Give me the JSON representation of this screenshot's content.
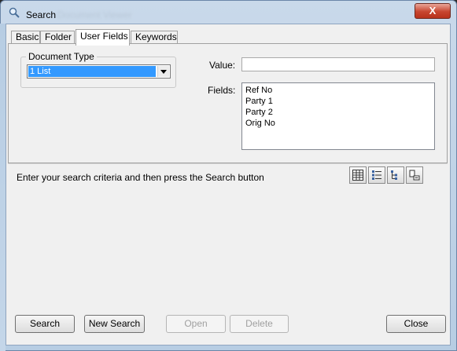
{
  "window": {
    "title": "Search",
    "title_suffix_blurred": "Document Viewer",
    "close_glyph": "X"
  },
  "tabs": [
    {
      "label": "Basic",
      "active": false
    },
    {
      "label": "Folder",
      "active": false
    },
    {
      "label": "User Fields",
      "active": true
    },
    {
      "label": "Keywords",
      "active": false
    }
  ],
  "user_fields": {
    "document_type_label": "Document Type",
    "document_type_value": "1 List",
    "value_label": "Value:",
    "value_input": "",
    "fields_label": "Fields:",
    "fields": [
      "Ref No",
      "Party 1",
      "Party 2",
      "Orig No"
    ]
  },
  "instruction": "Enter your search criteria and then press the Search button",
  "view_icons": [
    "details-view-icon",
    "list-view-icon",
    "tree-view-icon",
    "preview-icon"
  ],
  "buttons": {
    "search": "Search",
    "new_search": "New Search",
    "open": "Open",
    "delete": "Delete",
    "close": "Close"
  },
  "colors": {
    "selection": "#3399ff",
    "client_bg": "#f0f0f0",
    "close_red": "#c7452f"
  }
}
